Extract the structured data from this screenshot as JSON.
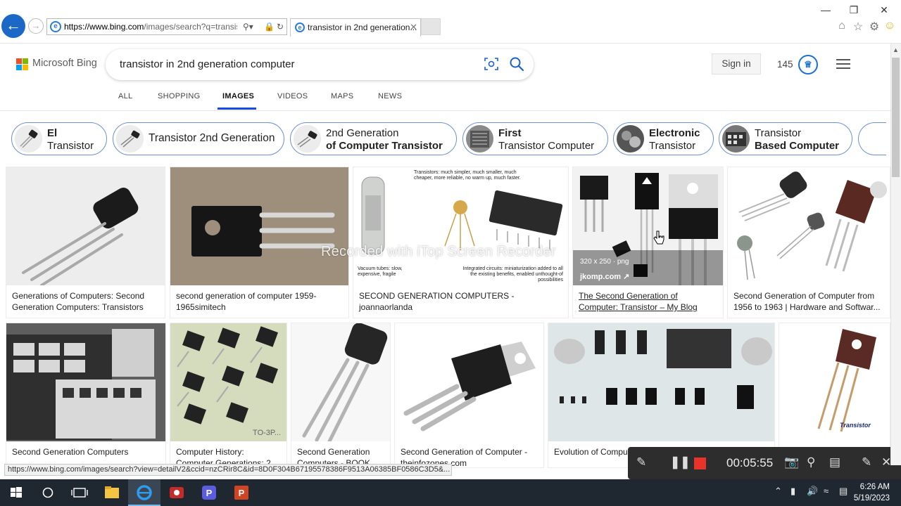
{
  "browser": {
    "url_host": "https://www.bing.com",
    "url_rest": "/images/search?q=transisto",
    "tab_title": "transistor in 2nd generation...",
    "status_url": "https://www.bing.com/images/search?view=detailV2&ccid=nzCRir8C&id=8D0F304B67195578386F9513A06385BF0586C3D5&..."
  },
  "header": {
    "logo_text": "Microsoft Bing",
    "query": "transistor in 2nd generation computer",
    "signin_label": "Sign in",
    "rewards_count": "145"
  },
  "nav": {
    "tabs": [
      "ALL",
      "SHOPPING",
      "IMAGES",
      "VIDEOS",
      "MAPS",
      "NEWS"
    ]
  },
  "chips": [
    {
      "line1": "El",
      "line2": "Transistor"
    },
    {
      "line1": "Transistor 2nd Generation",
      "line2": ""
    },
    {
      "line1": "2nd Generation",
      "line2": "of Computer Transistor"
    },
    {
      "line1": "First",
      "line2": "Transistor Computer"
    },
    {
      "line1": "Electronic",
      "line2": "Transistor"
    },
    {
      "line1": "Transistor",
      "line2": "Based Computer"
    }
  ],
  "results_row1": [
    {
      "caption": "Generations of Computers: Second Generation Computers: Transistors"
    },
    {
      "caption": "second generation of computer 1959-1965simitech"
    },
    {
      "caption": "SECOND GENERATION COMPUTERS - joannaorlanda",
      "text_top": "Transistors: much simpler, much smaller, much cheaper, more reliable, no warm up, much faster.",
      "text_left": "Vacuum tubes: slow, expensive, fragile",
      "text_right": "Integrated circuits: miniaturization added to all the existing benefits, enabled unthought-of possibilities"
    },
    {
      "caption": "The Second Generation of Computer: Transistor – My Blog",
      "size": "320 x 250 · png",
      "source": "jkomp.com"
    },
    {
      "caption": "Second Generation of Computer from 1956 to 1963 | Hardware and Softwar..."
    }
  ],
  "results_row2": [
    {
      "caption": "Second Generation Computers"
    },
    {
      "caption": "Computer History: Computer Generations: 2...",
      "img_label": "TO-3P..."
    },
    {
      "caption": "Second Generation Computers - BOOK..."
    },
    {
      "caption": "Second Generation of Computer - theinfozones.com"
    },
    {
      "caption": "Evolution of Computer timelines"
    },
    {
      "caption": "",
      "img_label": "Transistor"
    }
  ],
  "overlay": {
    "watermark": "Recorded with iTop Screen Recorder",
    "recorder_time": "00:05:55"
  },
  "taskbar": {
    "time": "6:26 AM",
    "date": "5/19/2023"
  },
  "colors": {
    "bing_blue": "#174ae4",
    "chip_border": "#6f8fd6",
    "ie_blue": "#1c68c6",
    "recorder_red": "#e8332a"
  }
}
